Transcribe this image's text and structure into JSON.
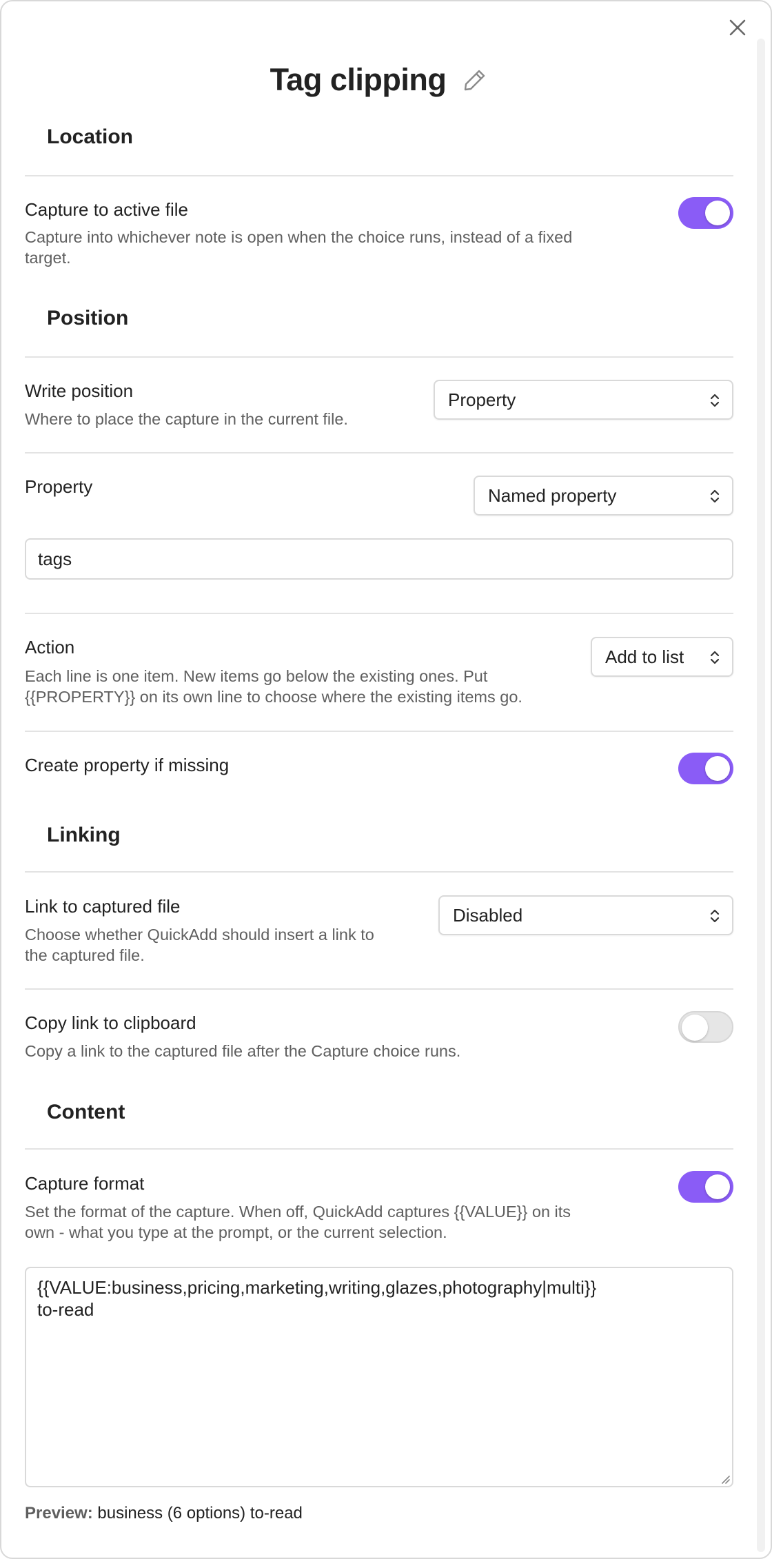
{
  "modal": {
    "title": "Tag clipping"
  },
  "sections": {
    "location": "Location",
    "position": "Position",
    "linking": "Linking",
    "content": "Content"
  },
  "capture_active": {
    "label": "Capture to active file",
    "desc_line1": "Capture into whichever note is open when the choice runs, instead of a fixed",
    "desc_line2": "target.",
    "enabled": true
  },
  "write_position": {
    "label": "Write position",
    "desc": "Where to place the capture in the current file.",
    "value": "Property"
  },
  "property": {
    "label": "Property",
    "mode": "Named property",
    "name": "tags"
  },
  "action": {
    "label": "Action",
    "desc_line1": "Each line is one item. New items go below the existing ones. Put",
    "desc_line2": "{{PROPERTY}} on its own line to choose where the existing items go.",
    "value": "Add to list"
  },
  "create_property": {
    "label": "Create property if missing",
    "enabled": true
  },
  "link_captured": {
    "label": "Link to captured file",
    "desc_line1": "Choose whether QuickAdd should insert a link to",
    "desc_line2": "the captured file.",
    "value": "Disabled"
  },
  "copy_link": {
    "label": "Copy link to clipboard",
    "desc": "Copy a link to the captured file after the Capture choice runs.",
    "enabled": false
  },
  "capture_format": {
    "label": "Capture format",
    "desc_line1": "Set the format of the capture. When off, QuickAdd captures {{VALUE}} on its",
    "desc_line2": "own - what you type at the prompt, or the current selection.",
    "enabled": true,
    "template": "{{VALUE:business,pricing,marketing,writing,glazes,photography|multi}}\nto-read"
  },
  "preview": {
    "label": "Preview:",
    "value": "business (6 options) to-read"
  },
  "colors": {
    "accent": "#8a5cf6",
    "toggle_off": "#e6e6e6",
    "border": "#d9d9d9",
    "muted_text": "#5f5f5f"
  }
}
